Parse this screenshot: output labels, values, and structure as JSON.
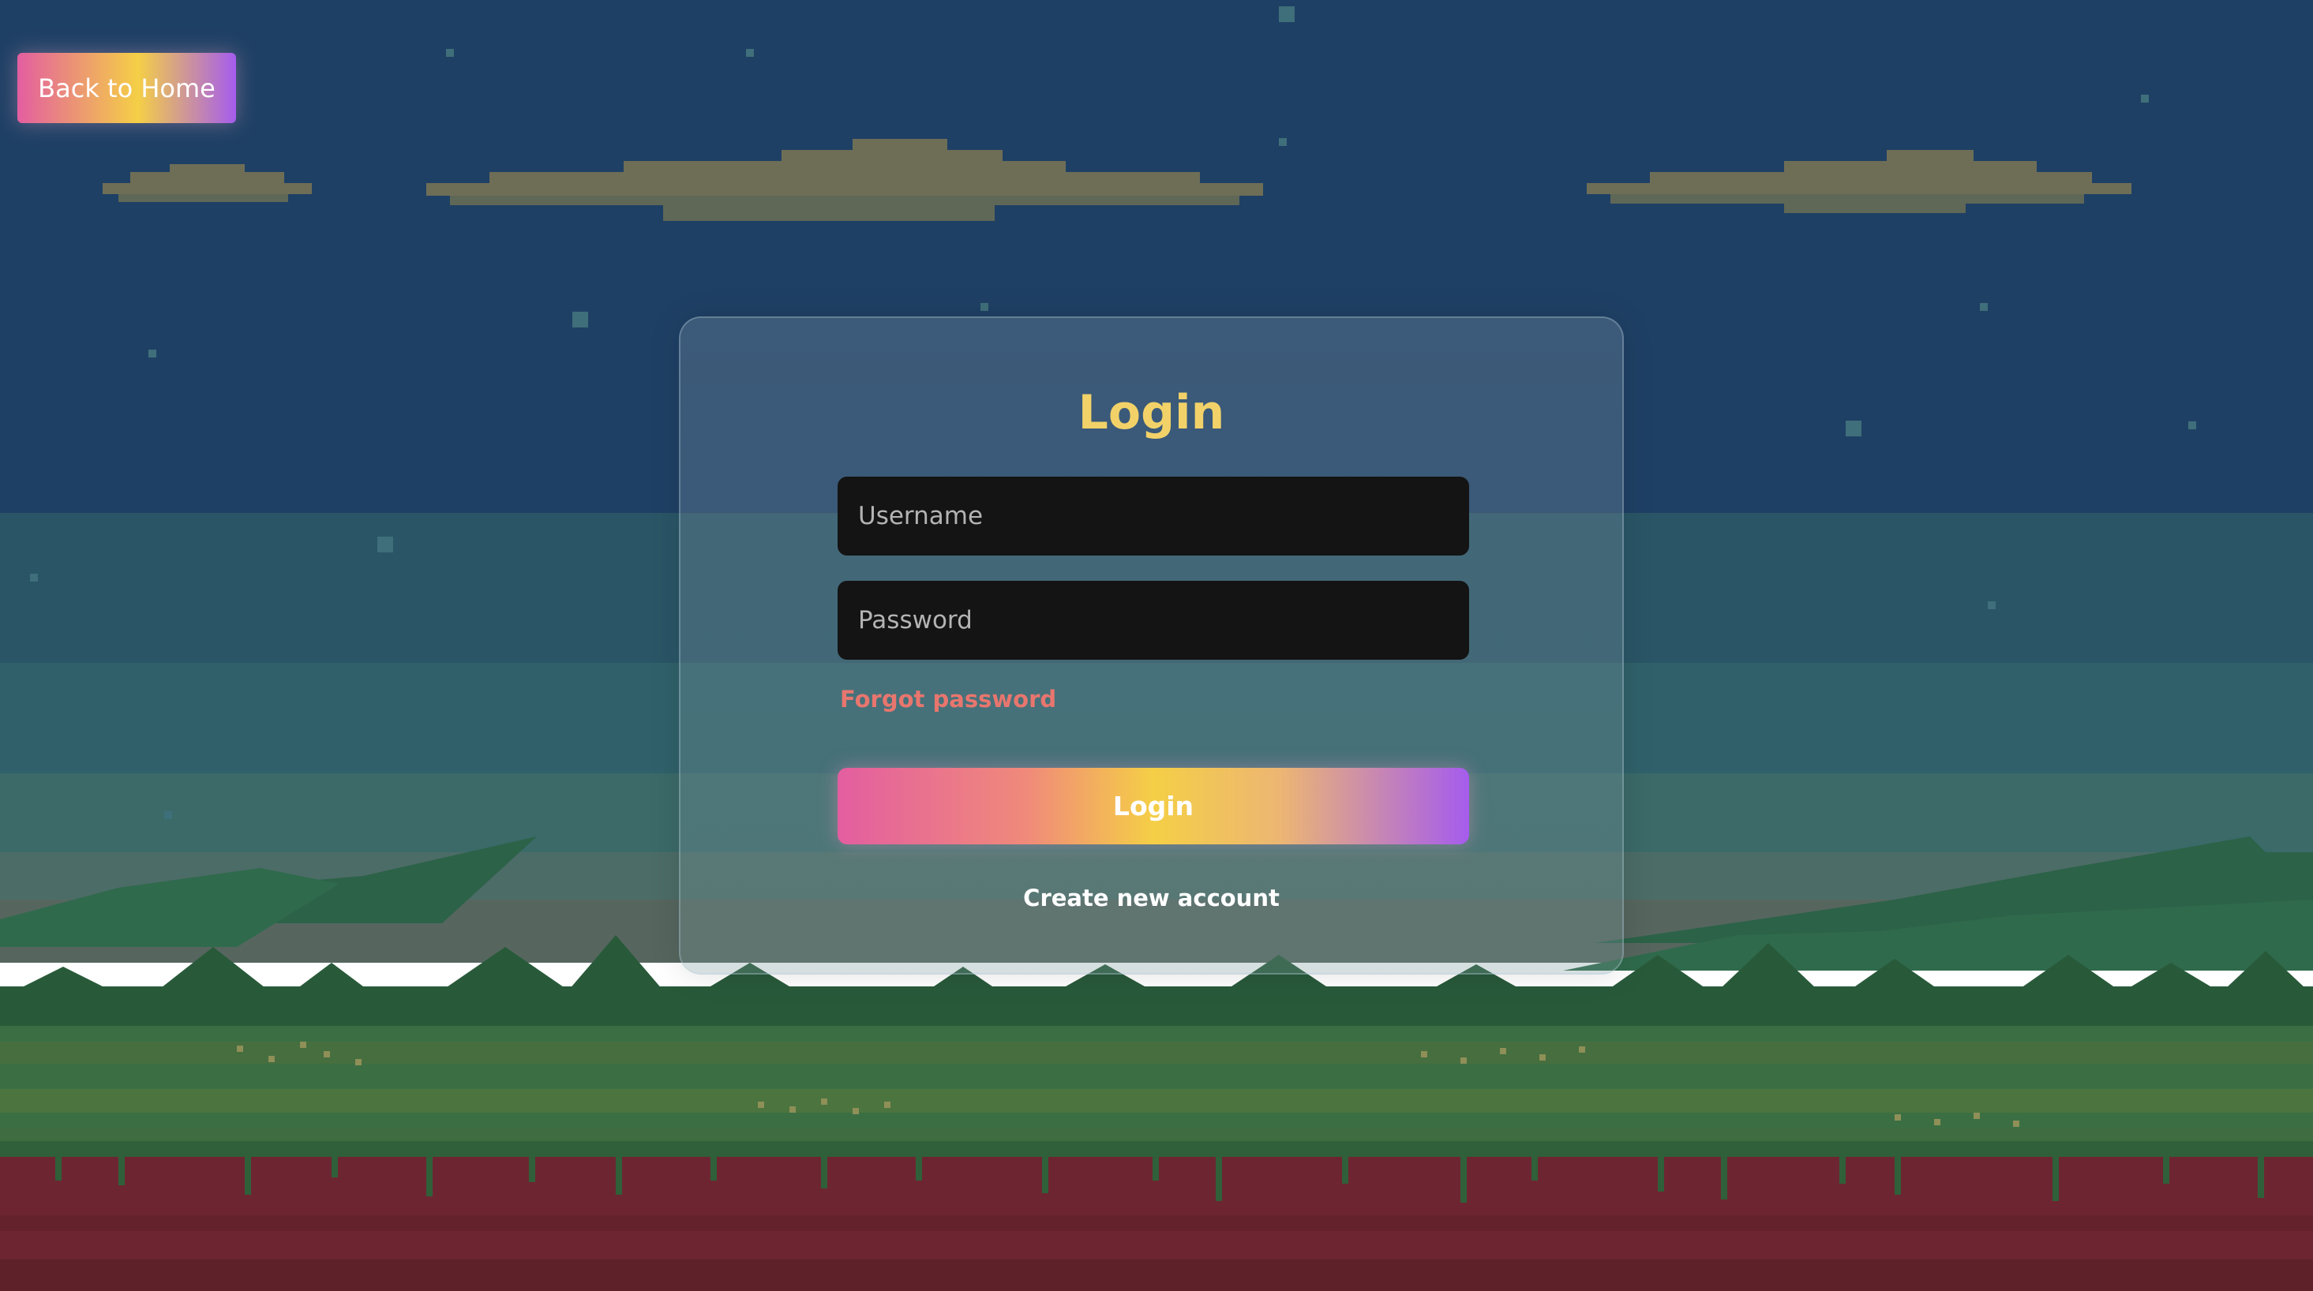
{
  "header": {
    "back_button_label": "Back to Home"
  },
  "login": {
    "title": "Login",
    "username_placeholder": "Username",
    "password_placeholder": "Password",
    "forgot_password_label": "Forgot password",
    "submit_label": "Login",
    "create_account_label": "Create new account"
  },
  "colors": {
    "title": "#f2d268",
    "forgot_link": "#e8766e",
    "gradient_pink": "#e35ea0",
    "gradient_yellow": "#f5cf46",
    "gradient_purple": "#a55ced",
    "input_background": "#141414",
    "sky": "#1f4065",
    "soil": "#6d2631"
  }
}
